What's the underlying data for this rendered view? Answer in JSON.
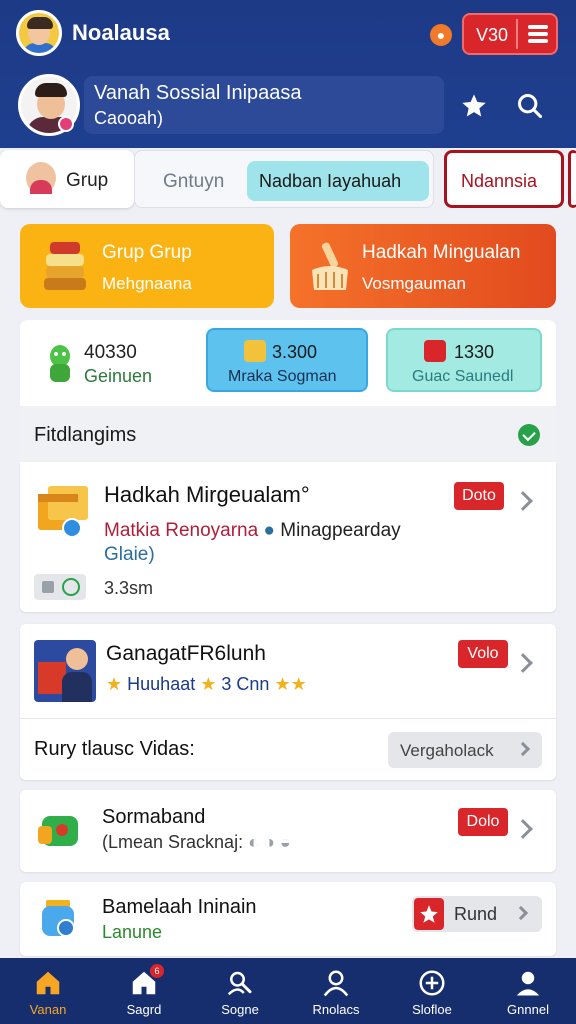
{
  "header": {
    "app_title": "Noalausa",
    "coin_value": "V30",
    "profile_name": "Vanah Sossial Inipaasa",
    "profile_sub": "Caooah)"
  },
  "tabs": [
    {
      "label": "Grup"
    },
    {
      "label": "Gntuyn"
    },
    {
      "label": "Nadban Iayahuah"
    },
    {
      "label": "Ndannsia"
    }
  ],
  "categories": [
    {
      "title": "Grup Grup",
      "subtitle": "Mehgnaana"
    },
    {
      "title": "Hadkah Mingualan",
      "subtitle": "Vosmgauman"
    }
  ],
  "stats": [
    {
      "number": "40330",
      "label": "Geinuen"
    },
    {
      "number": "3.300",
      "label": "Mraka Sogman"
    },
    {
      "number": "1330",
      "label": "Guac Saunedl"
    }
  ],
  "section": {
    "title": "Fitdlangims"
  },
  "items": [
    {
      "title": "Hadkah Mirgeualam°",
      "badge": "Doto",
      "line_a": "Matkia Renoyarna",
      "line_b": "Minagpearday",
      "line_c": "Glaie)",
      "size": "3.3sm"
    },
    {
      "title": "GanagatFR6lunh",
      "badge": "Volo",
      "sub_a": "Huuhaat",
      "sub_b": "3 Cnn",
      "question": "Rury tlausc Vidas:",
      "button": "Vergaholack"
    },
    {
      "title": "Sormaband",
      "badge": "Dolo",
      "sub": "(Lmean Sracknaj:"
    },
    {
      "title": "Bamelaah Ininain",
      "sub": "Lanune",
      "button": "Rund"
    }
  ],
  "nav": [
    {
      "label": "Vanan",
      "icon": "home-icon"
    },
    {
      "label": "Sagrd",
      "icon": "house-badge-icon",
      "badge": "6"
    },
    {
      "label": "Sogne",
      "icon": "search-people-icon"
    },
    {
      "label": "Rnolacs",
      "icon": "person-icon"
    },
    {
      "label": "Slofloe",
      "icon": "plus-circle-icon"
    },
    {
      "label": "Gnnnel",
      "icon": "profile-icon"
    }
  ],
  "colors": {
    "header_bg": "#1d3a86",
    "accent_red": "#d8262b",
    "accent_orange": "#f6a623",
    "nav_bg": "#162e6e"
  }
}
